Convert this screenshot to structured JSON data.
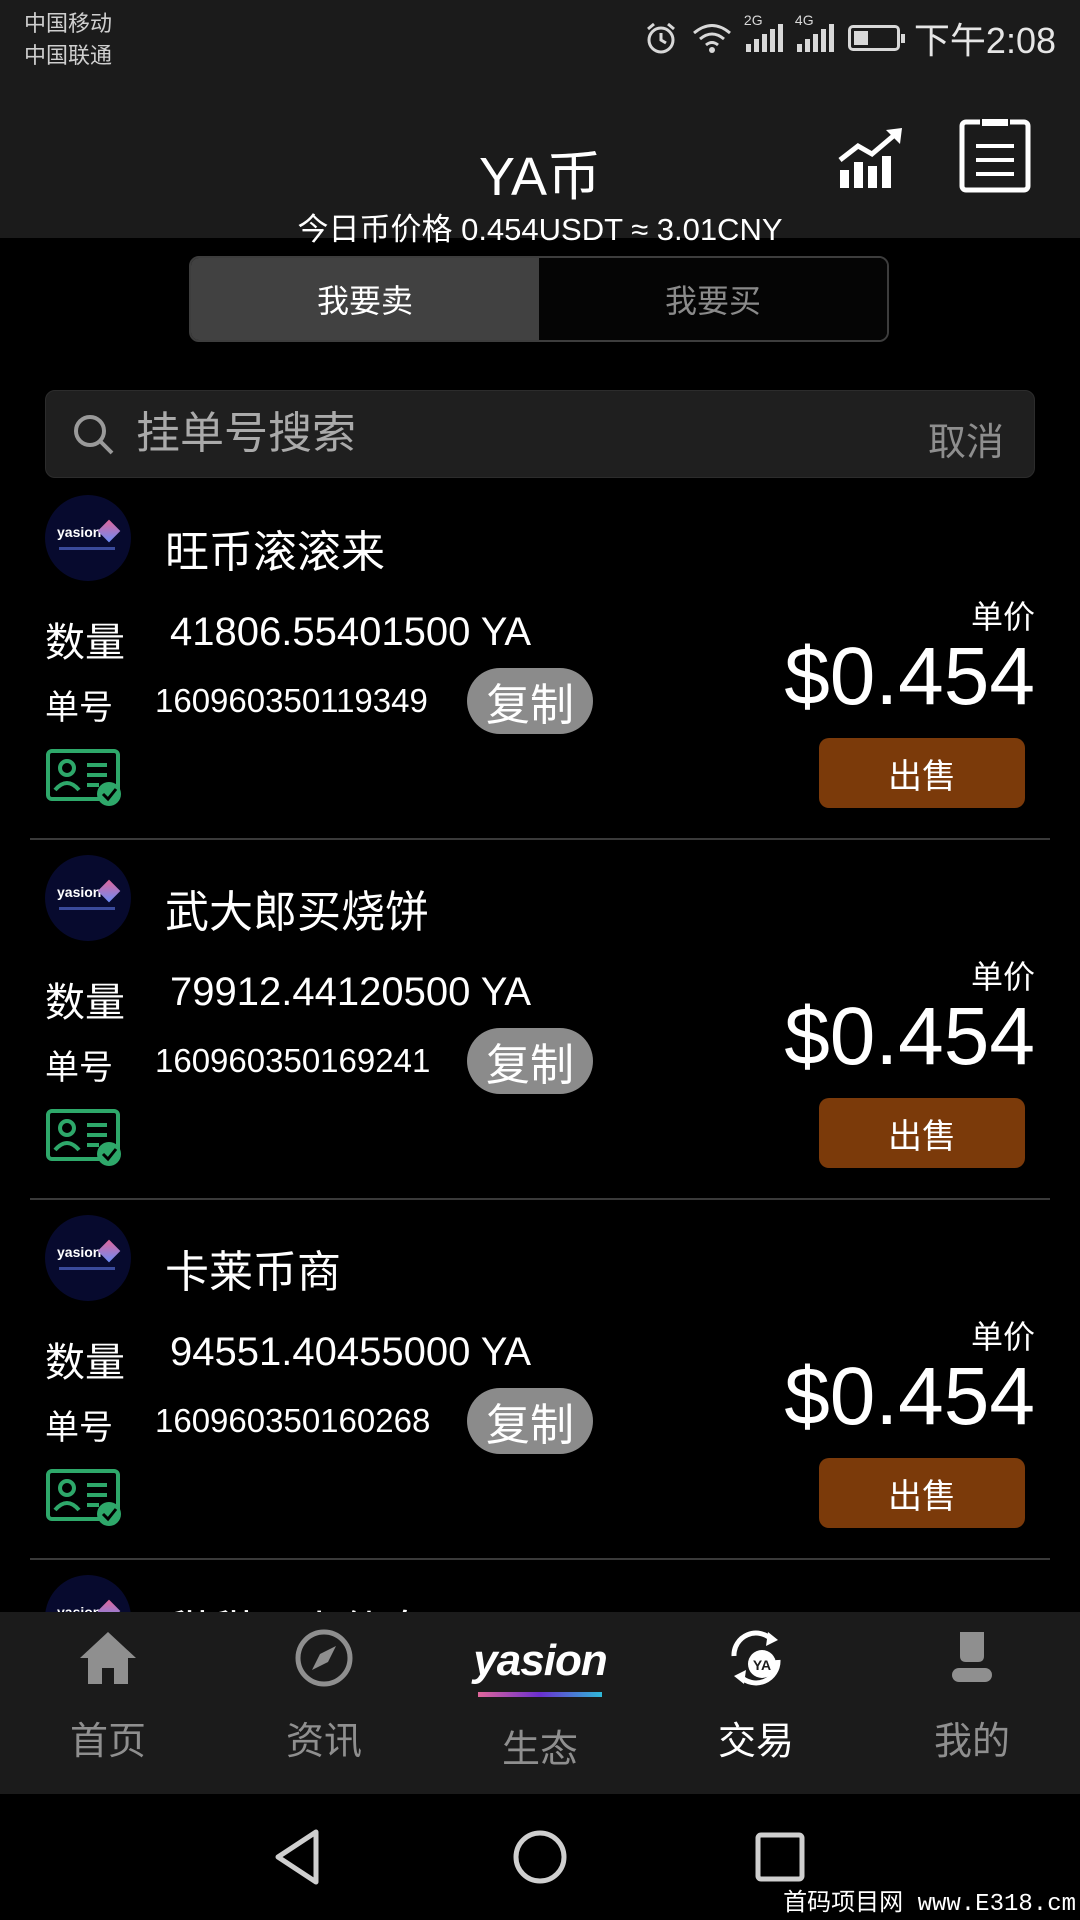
{
  "status_bar": {
    "carrier_1": "中国移动",
    "carrier_2": "中国联通",
    "network_1": "2G",
    "network_2": "4G",
    "time": "下午2:08",
    "battery_level": 0.35
  },
  "header": {
    "title": "YA币",
    "price_line": "今日币价格 0.454USDT ≈ 3.01CNY"
  },
  "segment": {
    "sell_tab": "我要卖",
    "buy_tab": "我要买",
    "active": "sell"
  },
  "search": {
    "placeholder": "挂单号搜索",
    "cancel_label": "取消"
  },
  "labels": {
    "quantity": "数量",
    "order_no": "单号",
    "copy": "复制",
    "unit_price": "单价",
    "sell": "出售"
  },
  "orders": [
    {
      "seller": "旺币滚滚来",
      "quantity": "41806.55401500 YA",
      "order_no": "160960350119349",
      "price": "$0.454"
    },
    {
      "seller": "武大郎买烧饼",
      "quantity": "79912.44120500 YA",
      "order_no": "160960350169241",
      "price": "$0.454"
    },
    {
      "seller": "卡莱币商",
      "quantity": "94551.40455000 YA",
      "order_no": "160960350160268",
      "price": "$0.454"
    },
    {
      "seller": "甜甜圈小仙女"
    }
  ],
  "avatar_brand": "yasion",
  "tabbar": {
    "home": "首页",
    "news": "资讯",
    "eco": "生态",
    "eco_logo": "yasion",
    "trade": "交易",
    "trade_badge": "YA",
    "mine": "我的",
    "active": "trade"
  },
  "watermark": "首码项目网 www.E318.cm",
  "colors": {
    "background": "#000000",
    "header_bg": "#1b1b1b",
    "sell_button": "#7b3a0a",
    "copy_button": "#8b8b8b",
    "verify_green": "#2ea86a"
  },
  "icons": {
    "chart": "trend-chart-icon",
    "orders": "order-list-icon",
    "search": "search-icon",
    "verified": "verified-id-icon",
    "home": "home-icon",
    "news": "compass-icon",
    "trade": "trade-exchange-icon",
    "mine": "person-icon"
  }
}
